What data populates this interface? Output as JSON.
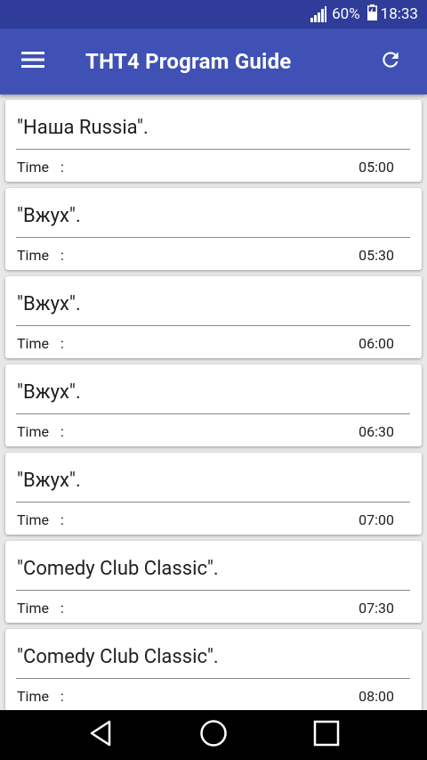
{
  "status_bar": {
    "battery_percent": "60%",
    "time": "18:33",
    "icons": [
      "signal-icon",
      "battery-icon"
    ]
  },
  "app_bar": {
    "title": "THT4 Program Guide",
    "icons": [
      "menu-icon",
      "refresh-icon"
    ]
  },
  "programs": [
    {
      "title": "\"Наша Russia\".",
      "time_label": "Time",
      "separator": ":",
      "time": "05:00"
    },
    {
      "title": "\"Вжух\".",
      "time_label": "Time",
      "separator": ":",
      "time": "05:30"
    },
    {
      "title": "\"Вжух\".",
      "time_label": "Time",
      "separator": ":",
      "time": "06:00"
    },
    {
      "title": "\"Вжух\".",
      "time_label": "Time",
      "separator": ":",
      "time": "06:30"
    },
    {
      "title": "\"Вжух\".",
      "time_label": "Time",
      "separator": ":",
      "time": "07:00"
    },
    {
      "title": "\"Comedy Club Classic\".",
      "time_label": "Time",
      "separator": ":",
      "time": "07:30"
    },
    {
      "title": "\"Comedy Club Classic\".",
      "time_label": "Time",
      "separator": ":",
      "time": "08:00"
    }
  ],
  "nav_bar": {
    "icons": [
      "back-icon",
      "home-icon",
      "recents-icon"
    ]
  },
  "colors": {
    "status_bar": "#2f3c99",
    "app_bar": "#3f51b5",
    "background": "#e8e8e8",
    "card": "#ffffff",
    "text": "#212121"
  }
}
